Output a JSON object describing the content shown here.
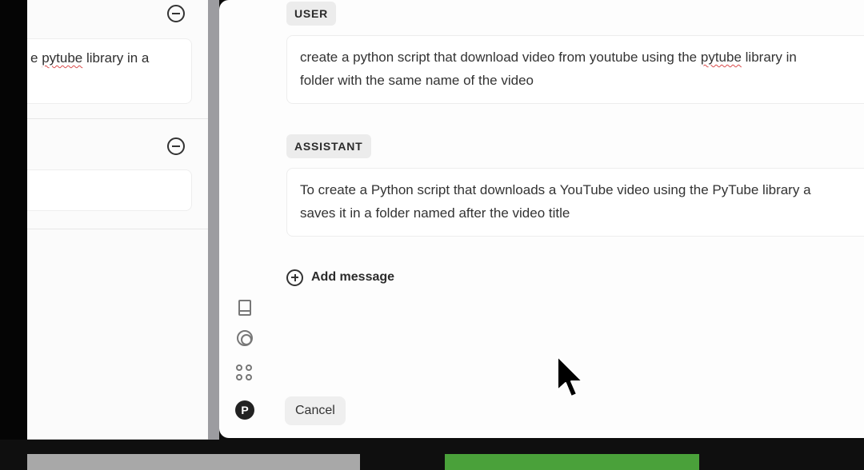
{
  "left_panel": {
    "card1": {
      "text_prefix": "e ",
      "text_squiggle": "pytube",
      "text_suffix": " library in a"
    }
  },
  "messages": [
    {
      "role": "USER",
      "line1_prefix": "create a python script that download video from youtube using the ",
      "line1_squiggle": "pytube",
      "line1_suffix": " library in",
      "line2": "folder with the same name of the video"
    },
    {
      "role": "ASSISTANT",
      "line1": "To create a Python script that downloads a YouTube video using the PyTube library a",
      "line2": "saves it in a folder named after the video title"
    }
  ],
  "add_message_label": "Add message",
  "cancel_label": "Cancel",
  "avatar_initial": "P",
  "colors": {
    "accent_bar_green": "#4aa13a",
    "gutter": "#9c9ca0"
  },
  "icons": {
    "left_panel": [
      "remove-circle-icon",
      "remove-circle-icon"
    ],
    "rail": [
      "book-icon",
      "lifebuoy-icon",
      "apps-grid-icon",
      "avatar"
    ],
    "add_message": "plus-circle-icon"
  }
}
